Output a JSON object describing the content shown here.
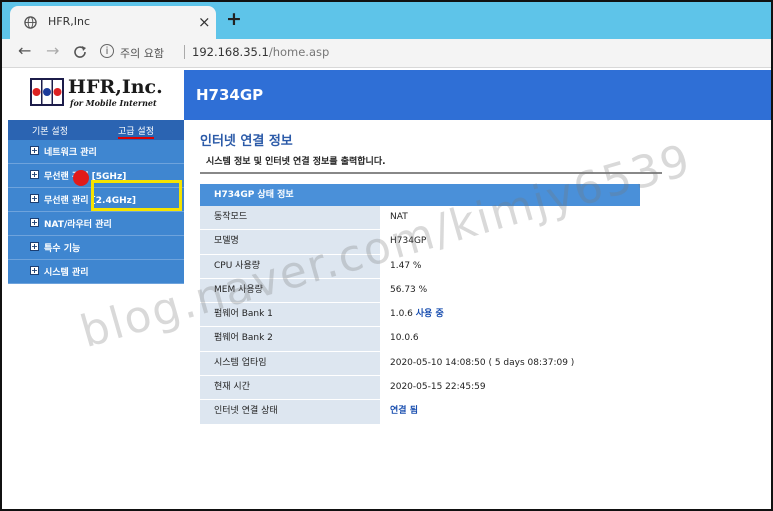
{
  "browser": {
    "tab_title": "HFR,Inc",
    "tab_close": "×",
    "new_tab": "+",
    "back": "←",
    "forward": "→",
    "reload": "C",
    "security_label": "주의 요함",
    "url_host": "192.168.35.1",
    "url_path": "/home.asp"
  },
  "logo": {
    "name": "HFR,Inc.",
    "tagline": "for Mobile Internet"
  },
  "header": {
    "model": "H734GP"
  },
  "sidebar": {
    "tabs": [
      {
        "label": "기본 설정"
      },
      {
        "label": "고급 설정"
      }
    ],
    "items": [
      {
        "label": "네트워크 관리"
      },
      {
        "label": "무선랜 관리 [5GHz]"
      },
      {
        "label": "무선랜 관리 [2.4GHz]"
      },
      {
        "label": "NAT/라우터 관리"
      },
      {
        "label": "특수 기능"
      },
      {
        "label": "시스템 관리"
      }
    ]
  },
  "content": {
    "section_title": "인터넷 연결 정보",
    "section_desc": "시스템 정보 및 인터넷 연결 정보를 출력합니다.",
    "table_header": "H734GP 상태 정보",
    "rows": [
      {
        "label": "동작모드",
        "value": "NAT"
      },
      {
        "label": "모델명",
        "value": "H734GP"
      },
      {
        "label": "CPU 사용량",
        "value": "1.47 %"
      },
      {
        "label": "MEM 사용량",
        "value": "56.73 %"
      },
      {
        "label": "펌웨어 Bank 1",
        "value": "1.0.6",
        "extra": "사용 중"
      },
      {
        "label": "펌웨어 Bank 2",
        "value": "10.0.6"
      },
      {
        "label": "시스템 업타임",
        "value": "2020-05-10 14:08:50 ( 5 days 08:37:09 )"
      },
      {
        "label": "현재 시간",
        "value": "2020-05-15 22:45:59"
      },
      {
        "label": "인터넷 연결 상태",
        "value": "연결 됨"
      }
    ]
  },
  "watermark": "blog.naver.com/kimjy6539",
  "colors": {
    "tabstrip": "#5ec4e9",
    "header": "#2f6fd6",
    "sidebar": "#3f86d0",
    "highlight_box": "#f5e300",
    "marker": "#e11a1a"
  }
}
